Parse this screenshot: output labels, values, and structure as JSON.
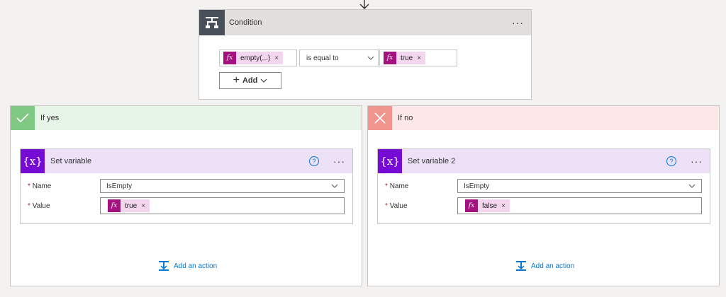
{
  "condition": {
    "title": "Condition",
    "menu": "···",
    "left_token": {
      "fx": "fx",
      "label": "empty(...)",
      "remove": "×"
    },
    "operator": "is equal to",
    "right_token": {
      "fx": "fx",
      "label": "true",
      "remove": "×"
    },
    "add_label": "Add"
  },
  "branches": [
    {
      "title": "If yes",
      "action": {
        "title": "Set variable",
        "help": "?",
        "menu": "···",
        "name_label": "Name",
        "name_value": "IsEmpty",
        "value_label": "Value",
        "value_token": {
          "fx": "fx",
          "label": "true",
          "remove": "×"
        }
      },
      "add_action": "Add an action"
    },
    {
      "title": "If no",
      "action": {
        "title": "Set variable 2",
        "help": "?",
        "menu": "···",
        "name_label": "Name",
        "name_value": "IsEmpty",
        "value_label": "Value",
        "value_token": {
          "fx": "fx",
          "label": "false",
          "remove": "×"
        }
      },
      "add_action": "Add an action"
    }
  ],
  "required_marker": "*",
  "icons": {
    "condition": "condition-icon",
    "yes": "check-icon",
    "no": "close-icon",
    "variable": "variable-icon",
    "add_action": "add-action-icon"
  },
  "colors": {
    "condition_icon_bg": "#484f58",
    "yes_header": "#e7f4e8",
    "yes_icon": "#7fc983",
    "no_header": "#fde7e9",
    "no_icon": "#f1958f",
    "variable_header": "#ede1f7",
    "variable_icon": "#770bd6",
    "fx_token": "#a4127f",
    "link": "#0078d4"
  }
}
